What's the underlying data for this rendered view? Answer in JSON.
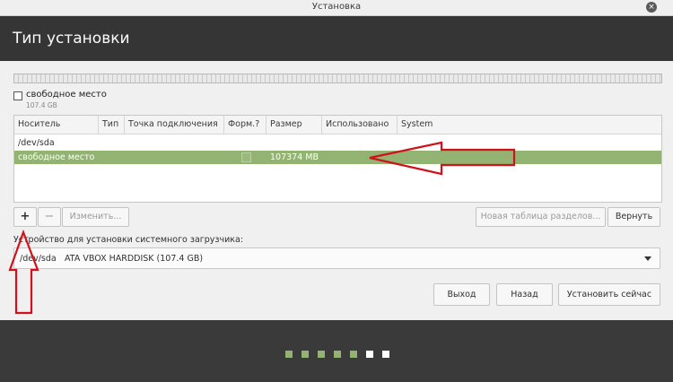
{
  "window": {
    "title": "Установка",
    "close_glyph": "×"
  },
  "header": {
    "title": "Тип установки"
  },
  "disk_legend": {
    "name": "свободное место",
    "size": "107.4 GB"
  },
  "table": {
    "columns": [
      "Носитель",
      "Тип",
      "Точка подключения",
      "Форм.?",
      "Размер",
      "Использовано",
      "System"
    ],
    "rows": [
      {
        "device": "/dev/sda"
      },
      {
        "device": "свободное место",
        "size": "107374 MB",
        "selected": true
      }
    ]
  },
  "toolbar": {
    "add_label": "+",
    "remove_label": "−",
    "change_label": "Изменить...",
    "new_table_label": "Новая таблица разделов...",
    "revert_label": "Вернуть"
  },
  "bootloader": {
    "label": "Устройство для установки системного загрузчика:",
    "device": "/dev/sda",
    "description": "ATA VBOX HARDDISK (107.4 GB)"
  },
  "actions": {
    "quit_label": "Выход",
    "back_label": "Назад",
    "install_label": "Установить сейчас"
  },
  "progress": {
    "completed_steps": 5,
    "total_steps": 7
  },
  "colors": {
    "accent": "#92b372",
    "annotation_arrow": "#d0131a"
  }
}
